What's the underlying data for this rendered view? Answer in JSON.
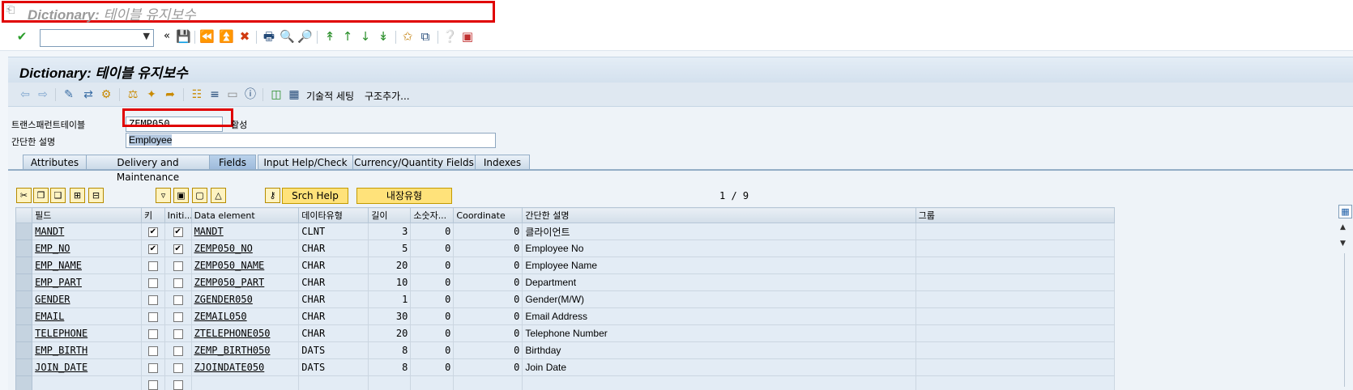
{
  "window": {
    "title_bold": "Dictionary:",
    "title_rest": " 테이블 유지보수"
  },
  "system_toolbar": {
    "command_value": ""
  },
  "header": {
    "title": "Dictionary: 테이블 유지보수"
  },
  "app_toolbar": {
    "tech_settings_label": "기술적 세팅",
    "add_structure_label": "구조추가..."
  },
  "form": {
    "table_label": "트랜스패런트테이블",
    "table_value": "ZEMP050",
    "status": "활성",
    "desc_label": "간단한 설명",
    "desc_value": "Employee"
  },
  "tabs": [
    {
      "label": "Attributes"
    },
    {
      "label": "Delivery and Maintenance"
    },
    {
      "label": "Fields"
    },
    {
      "label": "Input Help/Check"
    },
    {
      "label": "Currency/Quantity Fields"
    },
    {
      "label": "Indexes"
    }
  ],
  "active_tab": "Fields",
  "table_toolbar": {
    "srch_help_label": "Srch Help",
    "builtin_type_label": "내장유형",
    "pager": "1 / 9"
  },
  "grid": {
    "columns": [
      "필드",
      "키",
      "Initi...",
      "Data element",
      "데이타유형",
      "길이",
      "소숫자...",
      "Coordinate",
      "간단한 설명",
      "그룹"
    ],
    "rows": [
      {
        "field": "MANDT",
        "key": true,
        "init": true,
        "element": "MANDT",
        "type": "CLNT",
        "len": "3",
        "dec": "0",
        "coord": "0",
        "desc": "클라이언트",
        "group": ""
      },
      {
        "field": "EMP_NO",
        "key": true,
        "init": true,
        "element": "ZEMP050_NO",
        "type": "CHAR",
        "len": "5",
        "dec": "0",
        "coord": "0",
        "desc": "Employee No",
        "group": ""
      },
      {
        "field": "EMP_NAME",
        "key": false,
        "init": false,
        "element": "ZEMP050_NAME",
        "type": "CHAR",
        "len": "20",
        "dec": "0",
        "coord": "0",
        "desc": "Employee Name",
        "group": ""
      },
      {
        "field": "EMP_PART",
        "key": false,
        "init": false,
        "element": "ZEMP050_PART",
        "type": "CHAR",
        "len": "10",
        "dec": "0",
        "coord": "0",
        "desc": "Department",
        "group": ""
      },
      {
        "field": "GENDER",
        "key": false,
        "init": false,
        "element": "ZGENDER050",
        "type": "CHAR",
        "len": "1",
        "dec": "0",
        "coord": "0",
        "desc": "Gender(M/W)",
        "group": ""
      },
      {
        "field": "EMAIL",
        "key": false,
        "init": false,
        "element": "ZEMAIL050",
        "type": "CHAR",
        "len": "30",
        "dec": "0",
        "coord": "0",
        "desc": "Email Address",
        "group": ""
      },
      {
        "field": "TELEPHONE",
        "key": false,
        "init": false,
        "element": "ZTELEPHONE050",
        "type": "CHAR",
        "len": "20",
        "dec": "0",
        "coord": "0",
        "desc": "Telephone Number",
        "group": ""
      },
      {
        "field": "EMP_BIRTH",
        "key": false,
        "init": false,
        "element": "ZEMP_BIRTH050",
        "type": "DATS",
        "len": "8",
        "dec": "0",
        "coord": "0",
        "desc": "Birthday",
        "group": ""
      },
      {
        "field": "JOIN_DATE",
        "key": false,
        "init": false,
        "element": "ZJOINDATE050",
        "type": "DATS",
        "len": "8",
        "dec": "0",
        "coord": "0",
        "desc": "Join Date",
        "group": ""
      },
      {
        "field": "",
        "key": false,
        "init": false,
        "element": "",
        "type": "",
        "len": "",
        "dec": "",
        "coord": "",
        "desc": "",
        "group": ""
      }
    ]
  },
  "colors": {
    "highlight_red": "#e00000",
    "header_blue": "#d4e1ee",
    "yellow_button": "#ffe27a"
  }
}
